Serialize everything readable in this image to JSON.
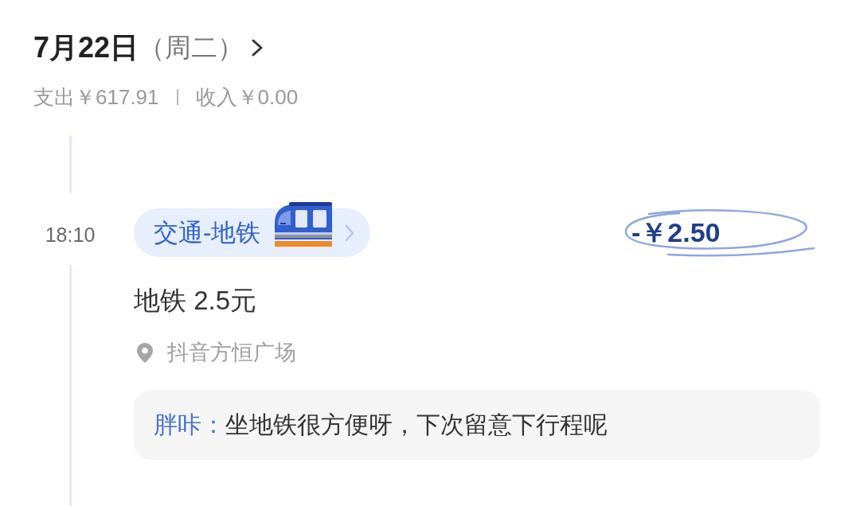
{
  "day": {
    "date": "7月22日",
    "weekday": "（周二）"
  },
  "summary": {
    "expense": "支出￥617.91",
    "income": "收入￥0.00"
  },
  "entries": [
    {
      "time": "18:10",
      "category": "交通-地铁",
      "amount": "-￥2.50",
      "title": "地铁 2.5元",
      "location": "抖音方恒广场",
      "comment": {
        "author": "胖咔：",
        "text": "坐地铁很方便呀，下次留意下行程呢"
      }
    }
  ]
}
